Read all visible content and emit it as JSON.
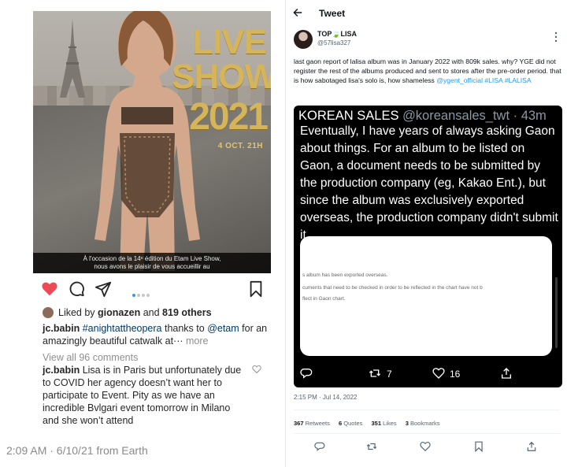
{
  "instagram": {
    "poster": {
      "title_line1": "LIVE",
      "title_line2": "SHOW",
      "year": "2021",
      "date": "4 OCT. 21H",
      "caption_line1": "À l'occasion de la 14ᵉ édition du Etam Live Show,",
      "caption_line2": "nous avons le plaisir de vous accueillir au"
    },
    "carousel_dots": 4,
    "likes_user": "gionazen",
    "likes_prefix": "Liked by",
    "likes_joiner": "and",
    "likes_others": "819 others",
    "caption_user": "jc.babin",
    "caption_hashtag": "#anightattheopera",
    "caption_mid": " thanks to ",
    "caption_mention": "@etam",
    "caption_rest": " for an amazingly beautiful catwalk at···",
    "caption_more": " more",
    "view_all": "View all 96 comments",
    "comment_user": "jc.babin",
    "comment_text": " Lisa is in Paris but unfortunately due to COVID her agency doesn’t want her to participate to Event. Pity as we have an incredible Bvlgari event tomorrow in Milano and she won’t attend",
    "footer": "2:09 AM · 6/10/21 from Earth"
  },
  "twitter": {
    "header_title": "Tweet",
    "author_name": "TOP🍃LISA",
    "author_handle": "@57lisa327",
    "body_text": "last gaon report of lalisa album was in January 2022 with 809k sales. why? YGE did not register the rest of the albums produced and sent to stores after the pre-order period. that is how sabotaged lisa's solo is, how shameless ",
    "body_mention": "@ygent_official",
    "body_tag1": "#LISA",
    "body_tag2": "#LALISA",
    "embed": {
      "author": "KOREAN SALES",
      "handle_time": "@koreansales_twt · 43m",
      "text": "Eventually, I have years of always asking Gaon about things. For an album to be listed on Gaon, a document needs to be submitted by the production company (eg, Kakao Ent.), but since the album was exclusively exported overseas, the production company didn't submit it.",
      "card_line1": "s album has been exported overseas.",
      "card_line2": "cuments that need to be checked in order to be reflected in the chart have not b",
      "card_line3": "flect in Gaon chart.",
      "retweets": "7",
      "likes": "16"
    },
    "timestamp": "2:15 PM · Jul 14, 2022",
    "stats": {
      "retweets_value": "367",
      "retweets_label": "Retweets",
      "quotes_value": "6",
      "quotes_label": "Quotes",
      "likes_value": "351",
      "likes_label": "Likes",
      "bookmarks_value": "3",
      "bookmarks_label": "Bookmarks"
    },
    "colors": {
      "link": "#1d9bf0",
      "like_heart": "#ed4956"
    }
  }
}
